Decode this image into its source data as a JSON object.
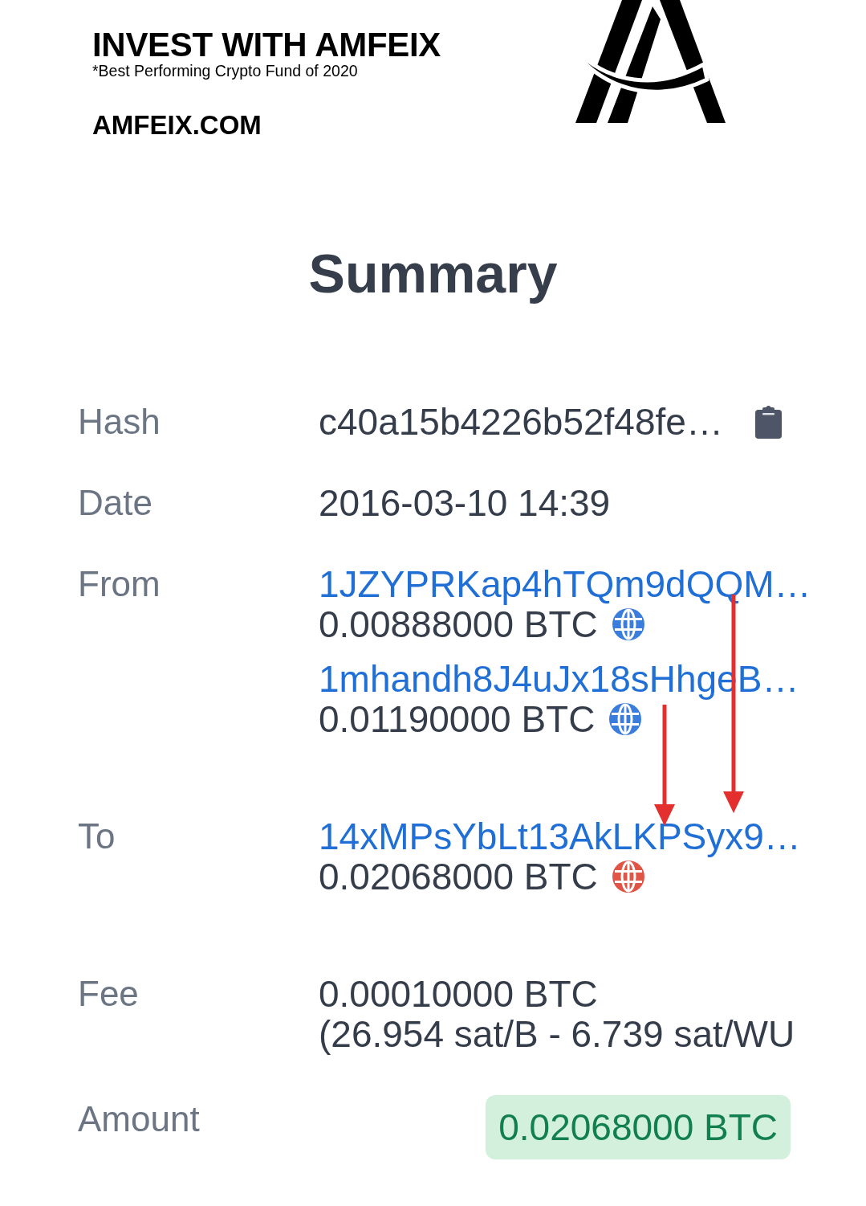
{
  "banner": {
    "title": "INVEST WITH AMFEIX",
    "tagline": "*Best Performing Crypto Fund of 2020",
    "website": "AMFEIX.COM"
  },
  "heading": "Summary",
  "details": [
    {
      "kind": "hash",
      "label": "Hash",
      "value": "c40a15b4226b52f48fe…"
    },
    {
      "kind": "text",
      "label": "Date",
      "value": "2016-03-10 14:39"
    },
    {
      "kind": "io",
      "label": "From",
      "entries": [
        {
          "address": "1JZYPRKap4hTQm9dQQM…",
          "amount": "0.00888000 BTC",
          "color": "#3b7ddd"
        },
        {
          "address": "1mhandh8J4uJx18sHhgeB…",
          "amount": "0.01190000 BTC",
          "color": "#3b7ddd"
        }
      ]
    },
    {
      "kind": "io",
      "label": "To",
      "entries": [
        {
          "address": "14xMPsYbLt13AkLKPSyx9…",
          "amount": "0.02068000 BTC",
          "color": "#e05545"
        }
      ]
    },
    {
      "kind": "lines",
      "label": "Fee",
      "lines": [
        "0.00010000 BTC",
        "(26.954 sat/B - 6.739 sat/WU"
      ]
    },
    {
      "kind": "badge",
      "label": "Amount",
      "value": "0.02068000 BTC"
    }
  ],
  "annotations": [
    {
      "kind": "arrow"
    },
    {
      "kind": "arrow"
    }
  ]
}
